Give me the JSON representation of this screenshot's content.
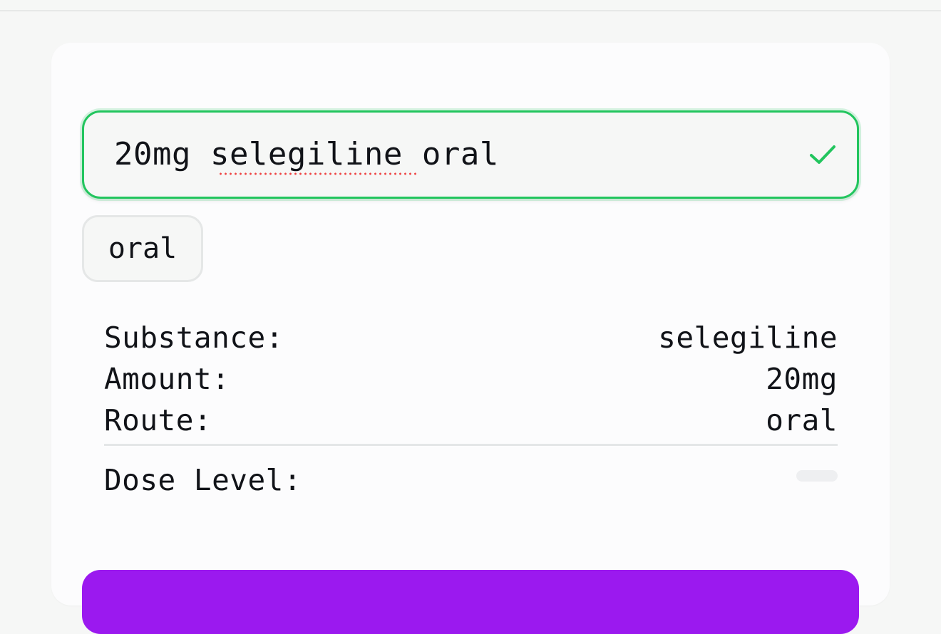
{
  "dose_input": {
    "value": "20mg selegiline oral",
    "status_icon": "check-icon",
    "valid_color": "#22c55e"
  },
  "route_chip": {
    "label": "oral"
  },
  "details": {
    "substance_label": "Substance:",
    "substance_value": "selegiline",
    "amount_label": "Amount:",
    "amount_value": "20mg",
    "route_label": "Route:",
    "route_value": "oral",
    "dose_level_label": "Dose Level:"
  },
  "submit_button": {
    "color": "#9b19ef"
  }
}
